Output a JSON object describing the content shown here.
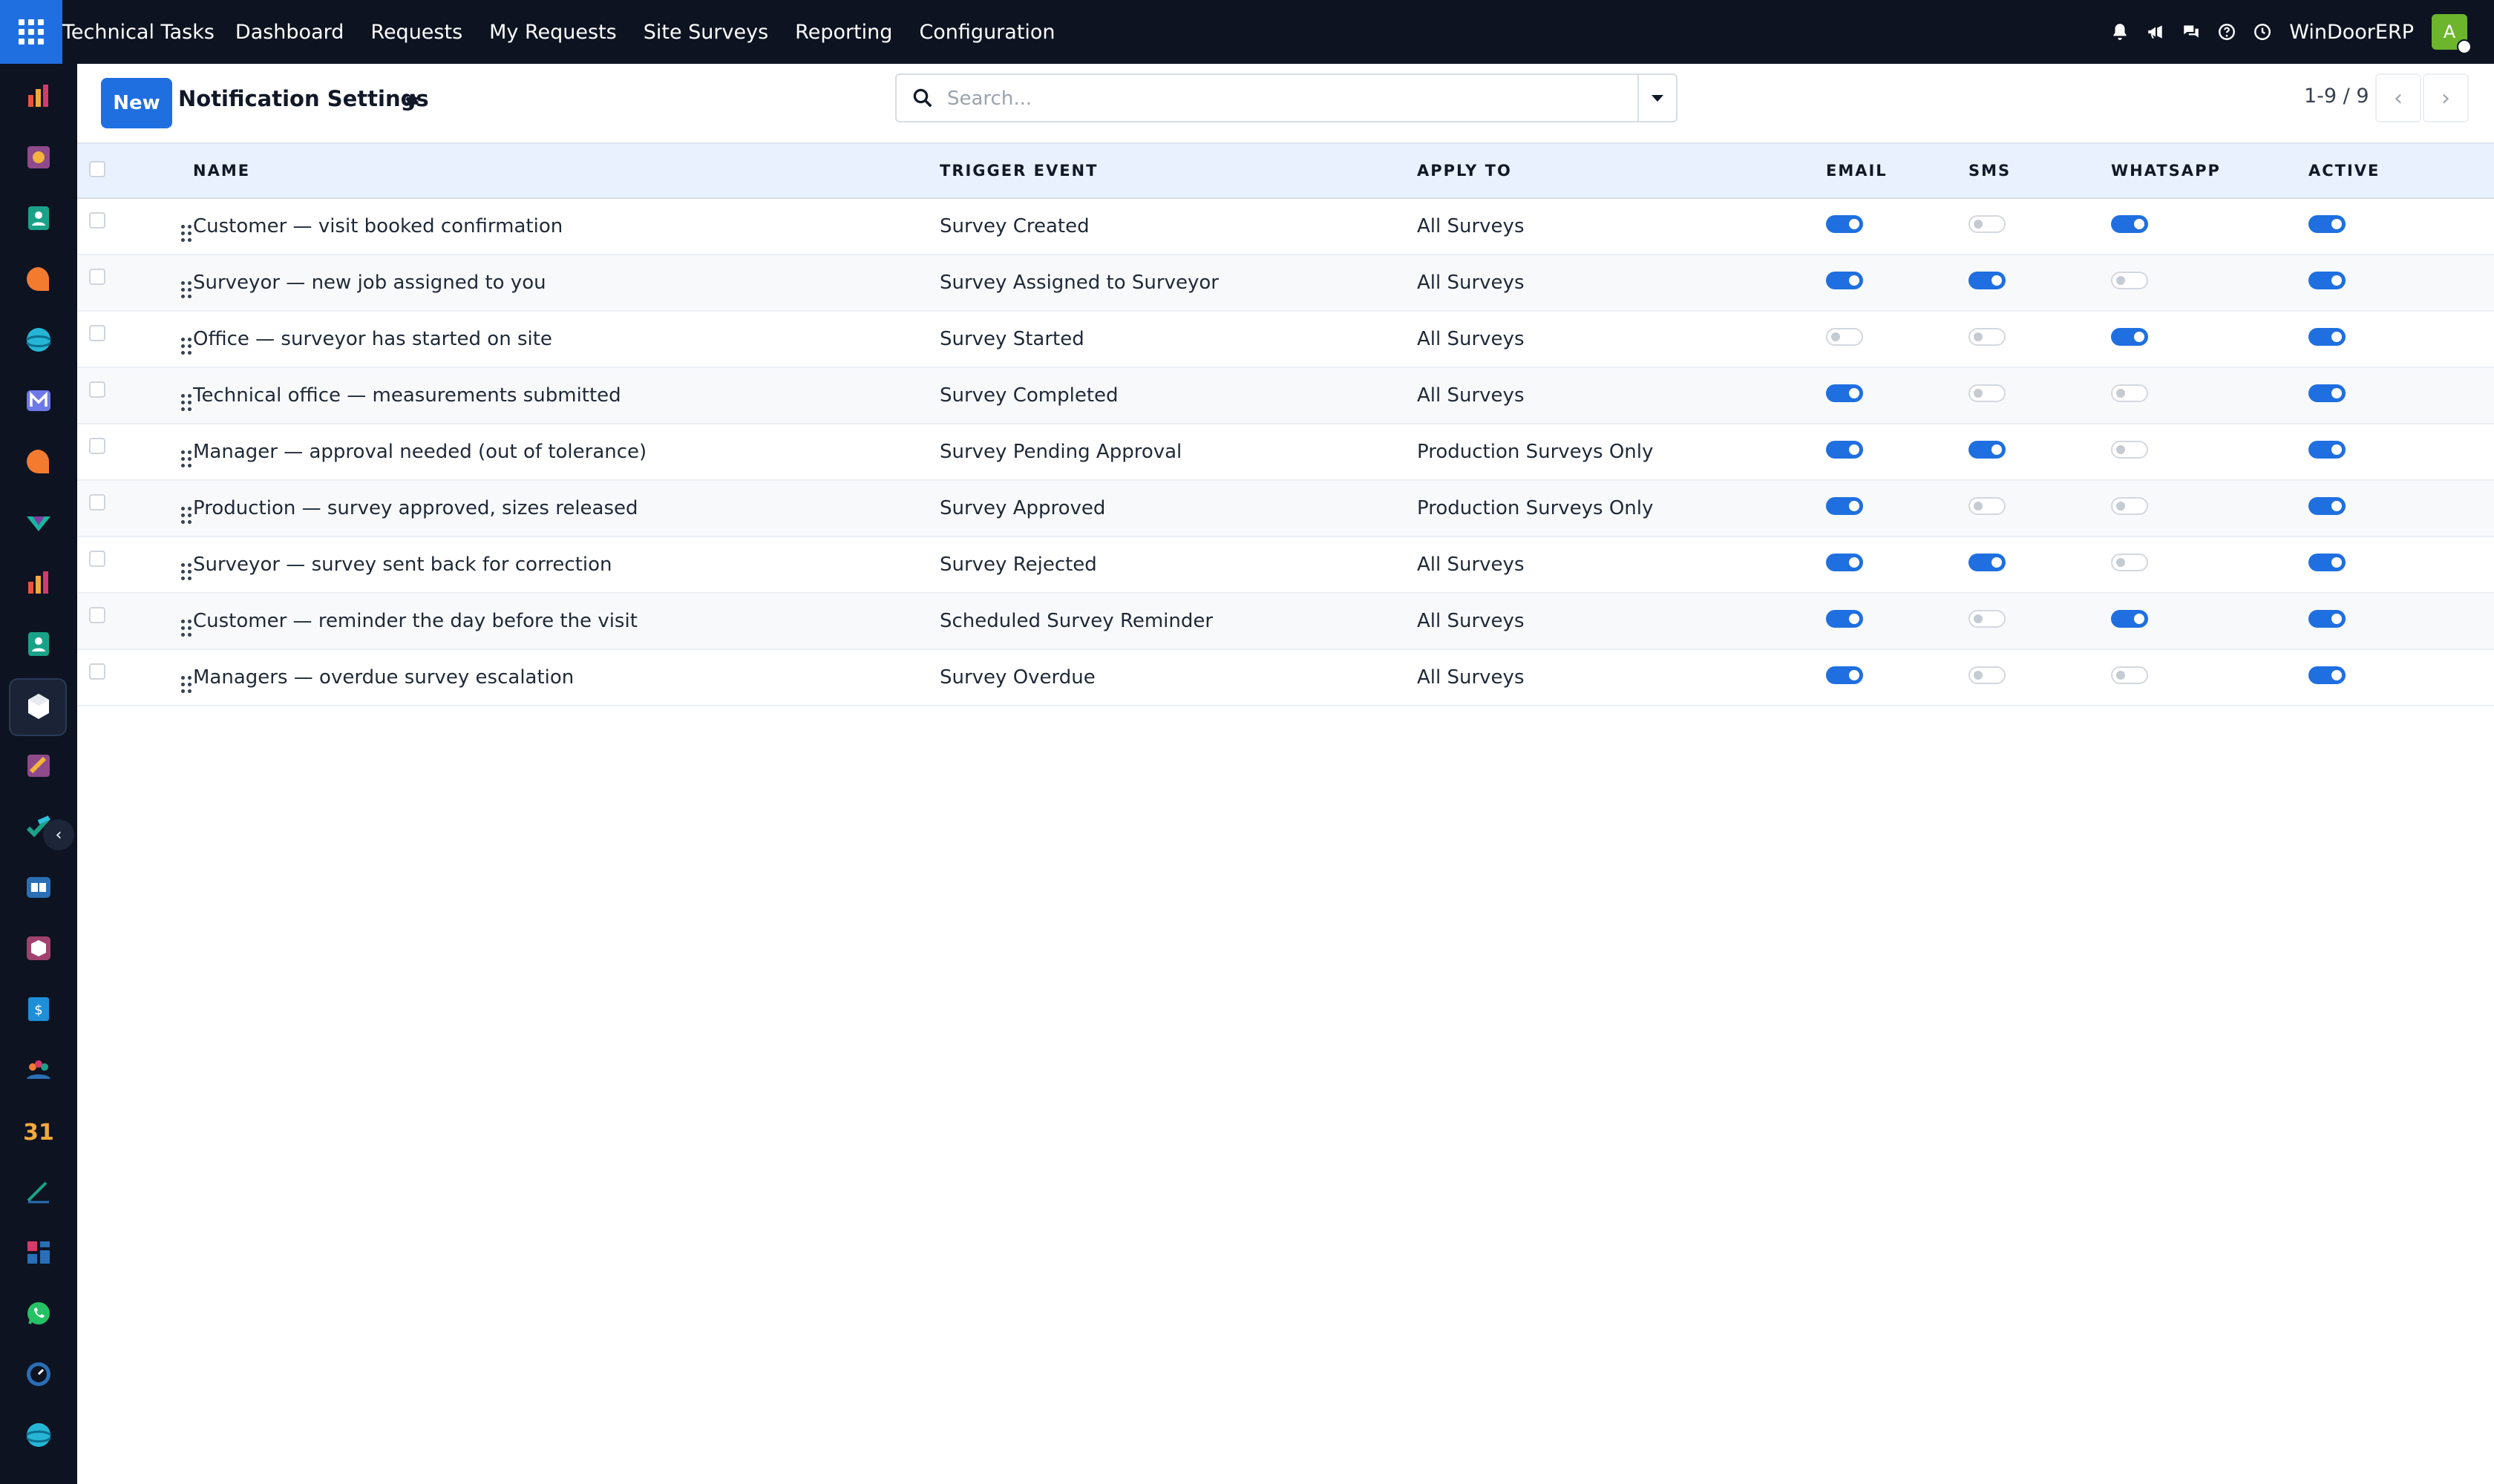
{
  "topbar": {
    "app_name": "Technical Tasks",
    "menu": [
      "Dashboard",
      "Requests",
      "My Requests",
      "Site Surveys",
      "Reporting",
      "Configuration"
    ],
    "company": "WinDoorERP",
    "avatar_letter": "A",
    "avatar_color": "#6cb52d",
    "icons": [
      "bell-icon",
      "megaphone-icon",
      "chat-icon",
      "help-icon",
      "clock-icon"
    ]
  },
  "control": {
    "new_label": "New",
    "title": "Notification Settings",
    "search_placeholder": "Search...",
    "pager": "1-9 / 9"
  },
  "colors": {
    "accent": "#1f6fe0",
    "topbar_bg": "#0d1321",
    "header_bg": "#e8f1fd"
  },
  "table": {
    "columns": [
      "NAME",
      "TRIGGER EVENT",
      "APPLY TO",
      "EMAIL",
      "SMS",
      "WHATSAPP",
      "ACTIVE"
    ],
    "rows": [
      {
        "name": "Customer — visit booked confirmation",
        "trigger": "Survey Created",
        "apply": "All Surveys",
        "email": true,
        "sms": false,
        "whatsapp": true,
        "active": true
      },
      {
        "name": "Surveyor — new job assigned to you",
        "trigger": "Survey Assigned to Surveyor",
        "apply": "All Surveys",
        "email": true,
        "sms": true,
        "whatsapp": false,
        "active": true
      },
      {
        "name": "Office — surveyor has started on site",
        "trigger": "Survey Started",
        "apply": "All Surveys",
        "email": false,
        "sms": false,
        "whatsapp": true,
        "active": true
      },
      {
        "name": "Technical office — measurements submitted",
        "trigger": "Survey Completed",
        "apply": "All Surveys",
        "email": true,
        "sms": false,
        "whatsapp": false,
        "active": true
      },
      {
        "name": "Manager — approval needed (out of tolerance)",
        "trigger": "Survey Pending Approval",
        "apply": "Production Surveys Only",
        "email": true,
        "sms": true,
        "whatsapp": false,
        "active": true
      },
      {
        "name": "Production — survey approved, sizes released",
        "trigger": "Survey Approved",
        "apply": "Production Surveys Only",
        "email": true,
        "sms": false,
        "whatsapp": false,
        "active": true
      },
      {
        "name": "Surveyor — survey sent back for correction",
        "trigger": "Survey Rejected",
        "apply": "All Surveys",
        "email": true,
        "sms": true,
        "whatsapp": false,
        "active": true
      },
      {
        "name": "Customer — reminder the day before the visit",
        "trigger": "Scheduled Survey Reminder",
        "apply": "All Surveys",
        "email": true,
        "sms": false,
        "whatsapp": true,
        "active": true
      },
      {
        "name": "Managers — overdue survey escalation",
        "trigger": "Survey Overdue",
        "apply": "All Surveys",
        "email": true,
        "sms": false,
        "whatsapp": false,
        "active": true
      }
    ]
  },
  "sidebar": {
    "apps": [
      "sales-app-icon",
      "project-app-icon",
      "contacts-app-icon",
      "discuss-app-icon",
      "website-app-icon",
      "email-marketing-app-icon",
      "live-chat-app-icon",
      "field-service-app-icon",
      "reporting-app-icon",
      "employees-app-icon",
      "technical-tasks-app-icon",
      "planning-app-icon",
      "todo-app-icon",
      "knowledge-app-icon",
      "inventory-app-icon",
      "invoicing-app-icon",
      "team-app-icon",
      "calendar-app-icon",
      "sign-app-icon",
      "dashboards-app-icon",
      "whatsapp-app-icon",
      "timesheet-app-icon",
      "website-2-app-icon"
    ],
    "active_index": 10,
    "calendar_label": "31"
  }
}
